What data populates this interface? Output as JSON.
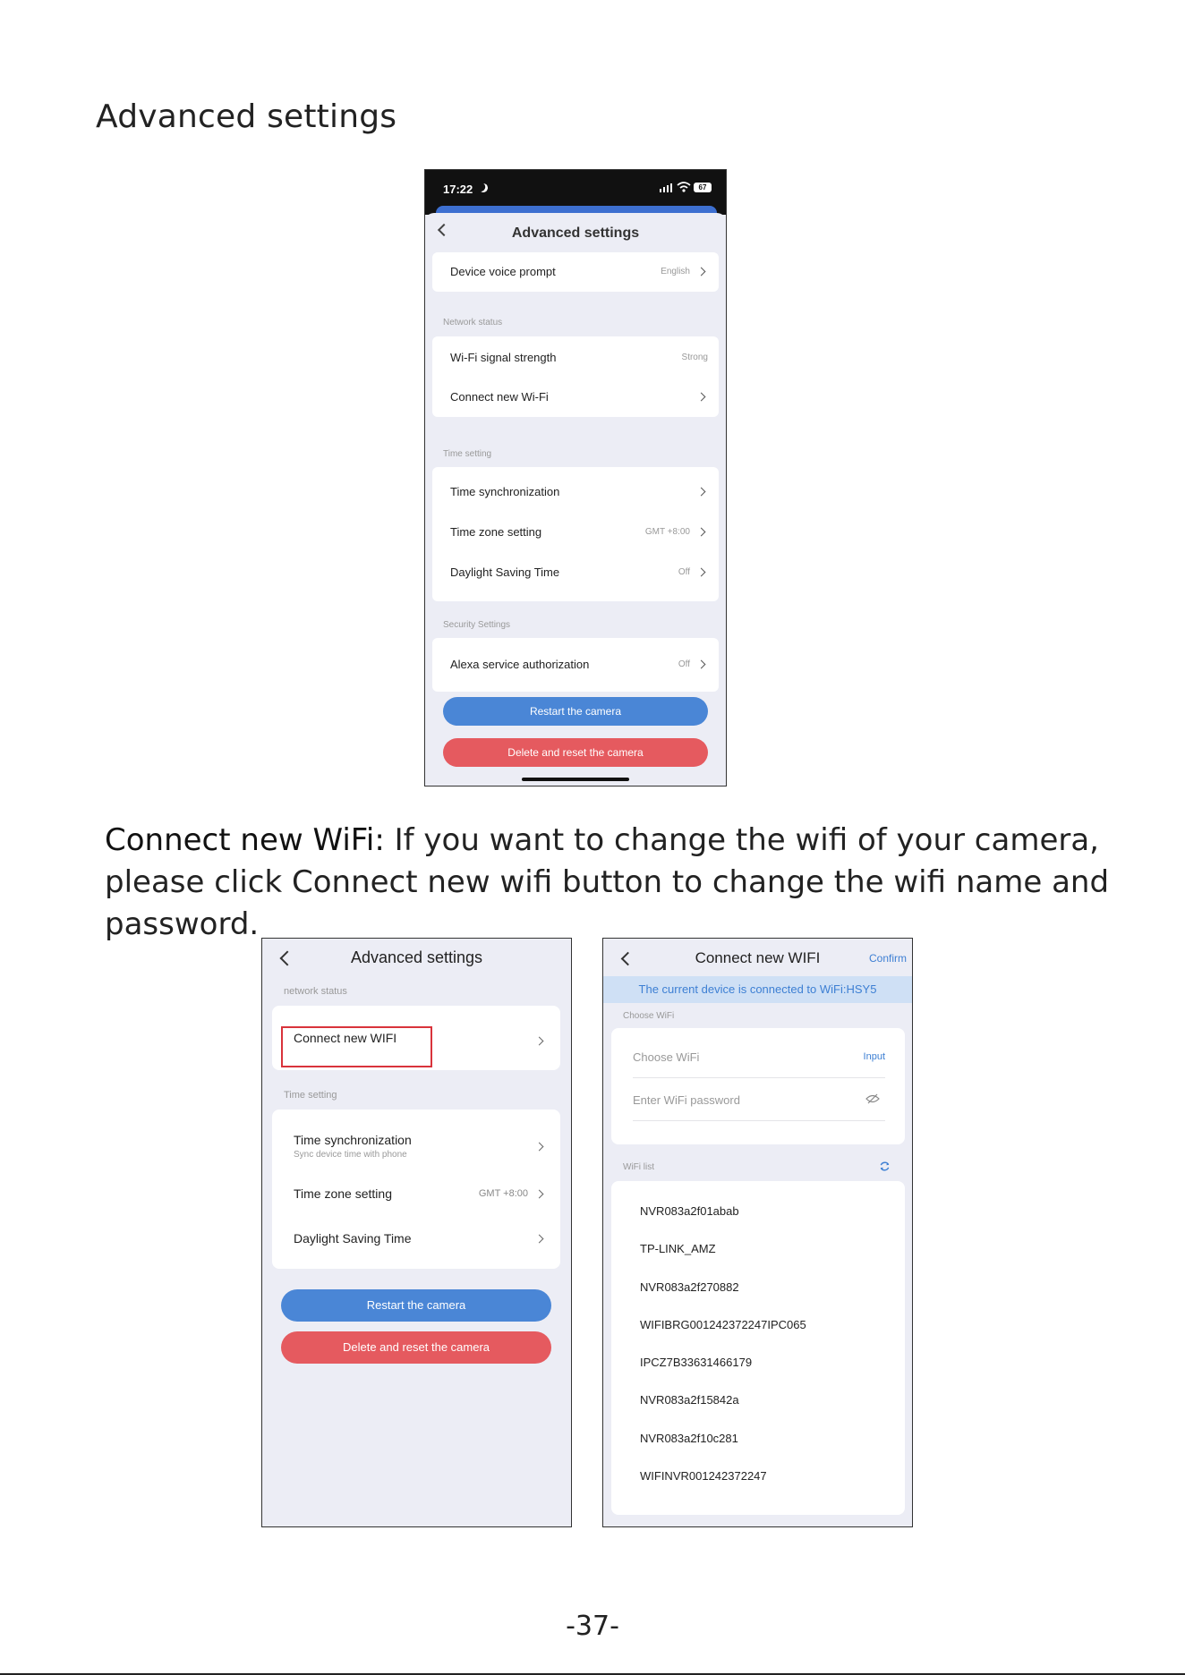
{
  "document": {
    "heading": "Advanced settings",
    "paragraph_lead": "Connect new WiFi:",
    "paragraph_rest": " If you want to change the wifi of your camera, please click Connect new wifi button to change the wifi name and password.",
    "page_number": "-37-"
  },
  "phone1": {
    "status_time": "17:22",
    "battery": "67",
    "title": "Advanced settings",
    "device_voice": {
      "label": "Device voice prompt",
      "value": "English"
    },
    "network_section": "Network status",
    "wifi_strength": {
      "label": "Wi-Fi signal strength",
      "value": "Strong"
    },
    "connect_wifi": {
      "label": "Connect new Wi-Fi"
    },
    "time_section": "Time setting",
    "time_sync": {
      "label": "Time synchronization"
    },
    "time_zone": {
      "label": "Time zone setting",
      "value": "GMT +8:00"
    },
    "dst": {
      "label": "Daylight Saving Time",
      "value": "Off"
    },
    "security_section": "Security Settings",
    "alexa": {
      "label": "Alexa service authorization",
      "value": "Off"
    },
    "restart_button": "Restart the camera",
    "delete_button": "Delete and reset the camera"
  },
  "phone2": {
    "title": "Advanced settings",
    "network_section": "network status",
    "connect_wifi": {
      "label": "Connect new WIFI"
    },
    "time_section": "Time setting",
    "time_sync": {
      "label": "Time synchronization",
      "sub": "Sync device time with phone"
    },
    "time_zone": {
      "label": "Time zone setting",
      "value": "GMT +8:00"
    },
    "dst": {
      "label": "Daylight Saving Time"
    },
    "restart_button": "Restart the camera",
    "delete_button": "Delete and reset the camera"
  },
  "phone3": {
    "title": "Connect new WIFI",
    "confirm": "Confirm",
    "banner": "The current device is connected to WiFi:HSY5",
    "choose_section": "Choose WiFi",
    "choose_placeholder": "Choose WiFi",
    "input_link": "Input",
    "password_placeholder": "Enter WiFi password",
    "list_section": "WiFi list",
    "wifi_list": [
      "NVR083a2f01abab",
      "TP-LINK_AMZ",
      "NVR083a2f270882",
      "WIFIBRG001242372247IPC065",
      "IPCZ7B33631466179",
      "NVR083a2f15842a",
      "NVR083a2f10c281",
      "WIFINVR001242372247"
    ]
  },
  "colors": {
    "accent_blue": "#4a86d6",
    "danger_red": "#e55a5f",
    "highlight_box": "#d9333b",
    "link_blue": "#3d7fd3"
  }
}
